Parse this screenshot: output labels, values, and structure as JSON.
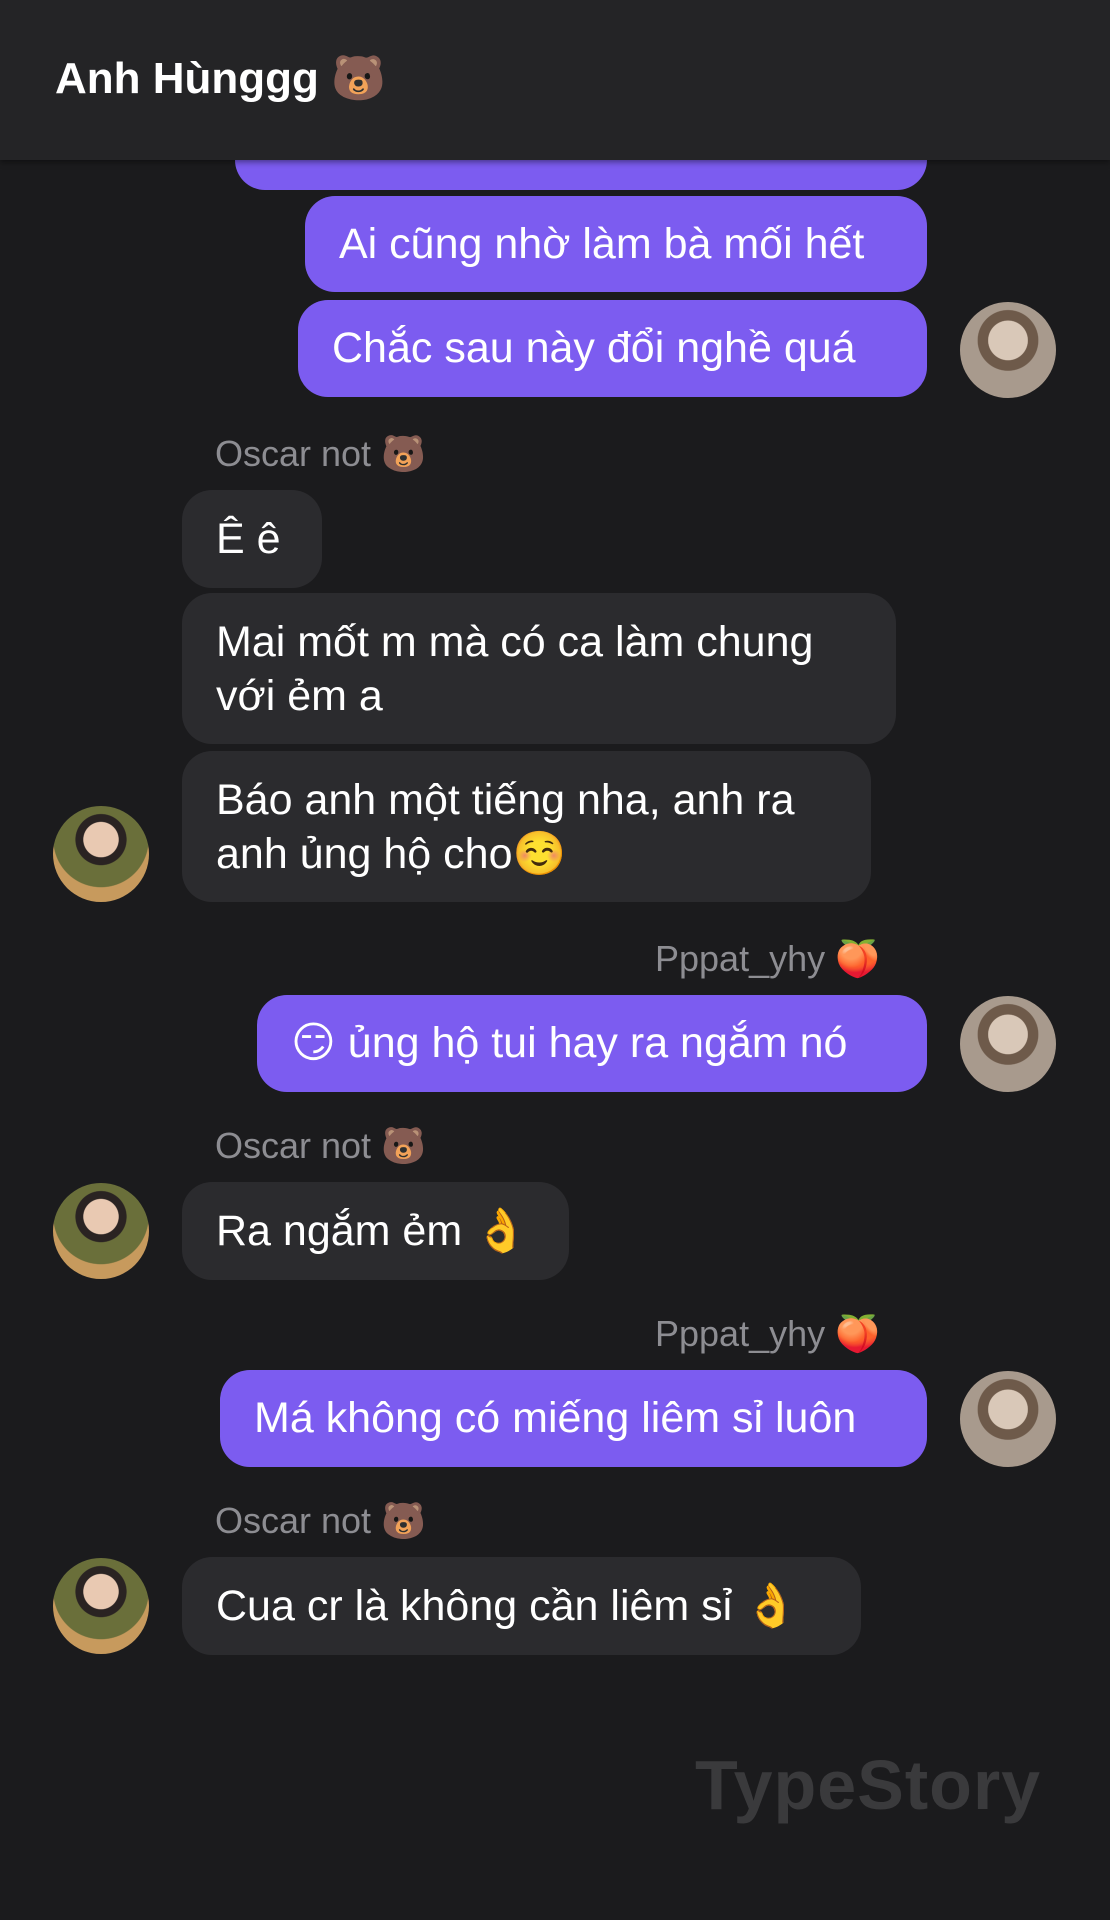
{
  "header": {
    "title": "Anh Hùnggg 🐻"
  },
  "messages": {
    "m1": "Ai cũng nhờ làm bà mối hết",
    "m2": "Chắc sau này đổi nghề quá",
    "s1": "Oscar not 🐻",
    "m3": "Ê ê",
    "m4": "Mai mốt m mà có ca làm chung với ẻm a",
    "m5": "Báo anh một tiếng nha, anh ra anh ủng hộ cho☺️",
    "s2": "Pppat_yhy 🍑",
    "m6": "😏 ủng hộ tui hay ra ngắm nó",
    "s3": "Oscar not 🐻",
    "m7": "Ra ngắm ẻm 👌",
    "s4": "Pppat_yhy 🍑",
    "m8": "Má không có miếng liêm sỉ luôn",
    "s5": "Oscar not 🐻",
    "m9": "Cua cr là không cần liêm sỉ 👌"
  },
  "watermark": "TypeStory",
  "colors": {
    "outgoing": "#7c5cf0",
    "incoming": "#2b2b2e",
    "background": "#1b1b1d"
  }
}
